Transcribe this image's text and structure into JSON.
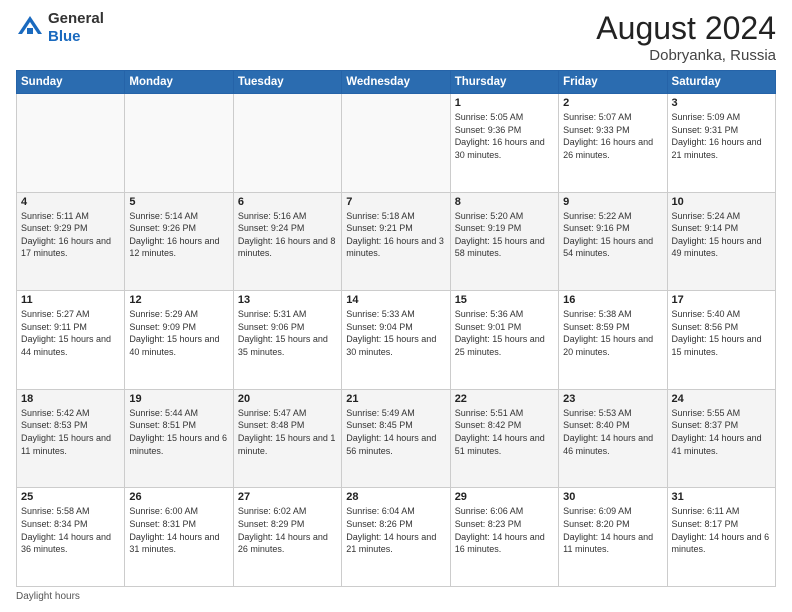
{
  "header": {
    "logo_general": "General",
    "logo_blue": "Blue",
    "month_year": "August 2024",
    "location": "Dobryanka, Russia"
  },
  "footer": {
    "note": "Daylight hours"
  },
  "days_of_week": [
    "Sunday",
    "Monday",
    "Tuesday",
    "Wednesday",
    "Thursday",
    "Friday",
    "Saturday"
  ],
  "weeks": [
    [
      {
        "day": "",
        "info": ""
      },
      {
        "day": "",
        "info": ""
      },
      {
        "day": "",
        "info": ""
      },
      {
        "day": "",
        "info": ""
      },
      {
        "day": "1",
        "info": "Sunrise: 5:05 AM\nSunset: 9:36 PM\nDaylight: 16 hours and 30 minutes."
      },
      {
        "day": "2",
        "info": "Sunrise: 5:07 AM\nSunset: 9:33 PM\nDaylight: 16 hours and 26 minutes."
      },
      {
        "day": "3",
        "info": "Sunrise: 5:09 AM\nSunset: 9:31 PM\nDaylight: 16 hours and 21 minutes."
      }
    ],
    [
      {
        "day": "4",
        "info": "Sunrise: 5:11 AM\nSunset: 9:29 PM\nDaylight: 16 hours and 17 minutes."
      },
      {
        "day": "5",
        "info": "Sunrise: 5:14 AM\nSunset: 9:26 PM\nDaylight: 16 hours and 12 minutes."
      },
      {
        "day": "6",
        "info": "Sunrise: 5:16 AM\nSunset: 9:24 PM\nDaylight: 16 hours and 8 minutes."
      },
      {
        "day": "7",
        "info": "Sunrise: 5:18 AM\nSunset: 9:21 PM\nDaylight: 16 hours and 3 minutes."
      },
      {
        "day": "8",
        "info": "Sunrise: 5:20 AM\nSunset: 9:19 PM\nDaylight: 15 hours and 58 minutes."
      },
      {
        "day": "9",
        "info": "Sunrise: 5:22 AM\nSunset: 9:16 PM\nDaylight: 15 hours and 54 minutes."
      },
      {
        "day": "10",
        "info": "Sunrise: 5:24 AM\nSunset: 9:14 PM\nDaylight: 15 hours and 49 minutes."
      }
    ],
    [
      {
        "day": "11",
        "info": "Sunrise: 5:27 AM\nSunset: 9:11 PM\nDaylight: 15 hours and 44 minutes."
      },
      {
        "day": "12",
        "info": "Sunrise: 5:29 AM\nSunset: 9:09 PM\nDaylight: 15 hours and 40 minutes."
      },
      {
        "day": "13",
        "info": "Sunrise: 5:31 AM\nSunset: 9:06 PM\nDaylight: 15 hours and 35 minutes."
      },
      {
        "day": "14",
        "info": "Sunrise: 5:33 AM\nSunset: 9:04 PM\nDaylight: 15 hours and 30 minutes."
      },
      {
        "day": "15",
        "info": "Sunrise: 5:36 AM\nSunset: 9:01 PM\nDaylight: 15 hours and 25 minutes."
      },
      {
        "day": "16",
        "info": "Sunrise: 5:38 AM\nSunset: 8:59 PM\nDaylight: 15 hours and 20 minutes."
      },
      {
        "day": "17",
        "info": "Sunrise: 5:40 AM\nSunset: 8:56 PM\nDaylight: 15 hours and 15 minutes."
      }
    ],
    [
      {
        "day": "18",
        "info": "Sunrise: 5:42 AM\nSunset: 8:53 PM\nDaylight: 15 hours and 11 minutes."
      },
      {
        "day": "19",
        "info": "Sunrise: 5:44 AM\nSunset: 8:51 PM\nDaylight: 15 hours and 6 minutes."
      },
      {
        "day": "20",
        "info": "Sunrise: 5:47 AM\nSunset: 8:48 PM\nDaylight: 15 hours and 1 minute."
      },
      {
        "day": "21",
        "info": "Sunrise: 5:49 AM\nSunset: 8:45 PM\nDaylight: 14 hours and 56 minutes."
      },
      {
        "day": "22",
        "info": "Sunrise: 5:51 AM\nSunset: 8:42 PM\nDaylight: 14 hours and 51 minutes."
      },
      {
        "day": "23",
        "info": "Sunrise: 5:53 AM\nSunset: 8:40 PM\nDaylight: 14 hours and 46 minutes."
      },
      {
        "day": "24",
        "info": "Sunrise: 5:55 AM\nSunset: 8:37 PM\nDaylight: 14 hours and 41 minutes."
      }
    ],
    [
      {
        "day": "25",
        "info": "Sunrise: 5:58 AM\nSunset: 8:34 PM\nDaylight: 14 hours and 36 minutes."
      },
      {
        "day": "26",
        "info": "Sunrise: 6:00 AM\nSunset: 8:31 PM\nDaylight: 14 hours and 31 minutes."
      },
      {
        "day": "27",
        "info": "Sunrise: 6:02 AM\nSunset: 8:29 PM\nDaylight: 14 hours and 26 minutes."
      },
      {
        "day": "28",
        "info": "Sunrise: 6:04 AM\nSunset: 8:26 PM\nDaylight: 14 hours and 21 minutes."
      },
      {
        "day": "29",
        "info": "Sunrise: 6:06 AM\nSunset: 8:23 PM\nDaylight: 14 hours and 16 minutes."
      },
      {
        "day": "30",
        "info": "Sunrise: 6:09 AM\nSunset: 8:20 PM\nDaylight: 14 hours and 11 minutes."
      },
      {
        "day": "31",
        "info": "Sunrise: 6:11 AM\nSunset: 8:17 PM\nDaylight: 14 hours and 6 minutes."
      }
    ]
  ]
}
